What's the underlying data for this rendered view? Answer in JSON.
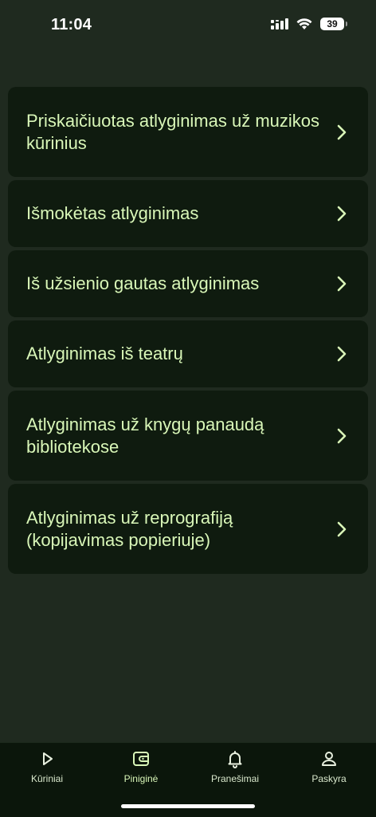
{
  "status": {
    "time": "11:04",
    "battery": "39",
    "icons": [
      "signal-icon",
      "wifi-icon",
      "battery-icon"
    ]
  },
  "menu": {
    "items": [
      {
        "label": "Priskaičiuotas atlyginimas už muzikos kūrinius"
      },
      {
        "label": "Išmokėtas atlyginimas"
      },
      {
        "label": "Iš užsienio gautas atlyginimas"
      },
      {
        "label": "Atlyginimas iš teatrų"
      },
      {
        "label": "Atlyginimas už knygų panaudą bibliotekose"
      },
      {
        "label": "Atlyginimas už reprografiją (kopijavimas popieriuje)"
      }
    ]
  },
  "tabbar": {
    "items": [
      {
        "label": "Kūriniai",
        "icon": "play-icon"
      },
      {
        "label": "Piniginė",
        "icon": "wallet-icon",
        "active": true
      },
      {
        "label": "Pranešimai",
        "icon": "bell-icon"
      },
      {
        "label": "Paskyra",
        "icon": "user-icon"
      }
    ]
  },
  "colors": {
    "background": "#1f2a1f",
    "card": "#0f1b0f",
    "text_accent": "#d9f7b8",
    "tabbar": "#0b160b"
  }
}
